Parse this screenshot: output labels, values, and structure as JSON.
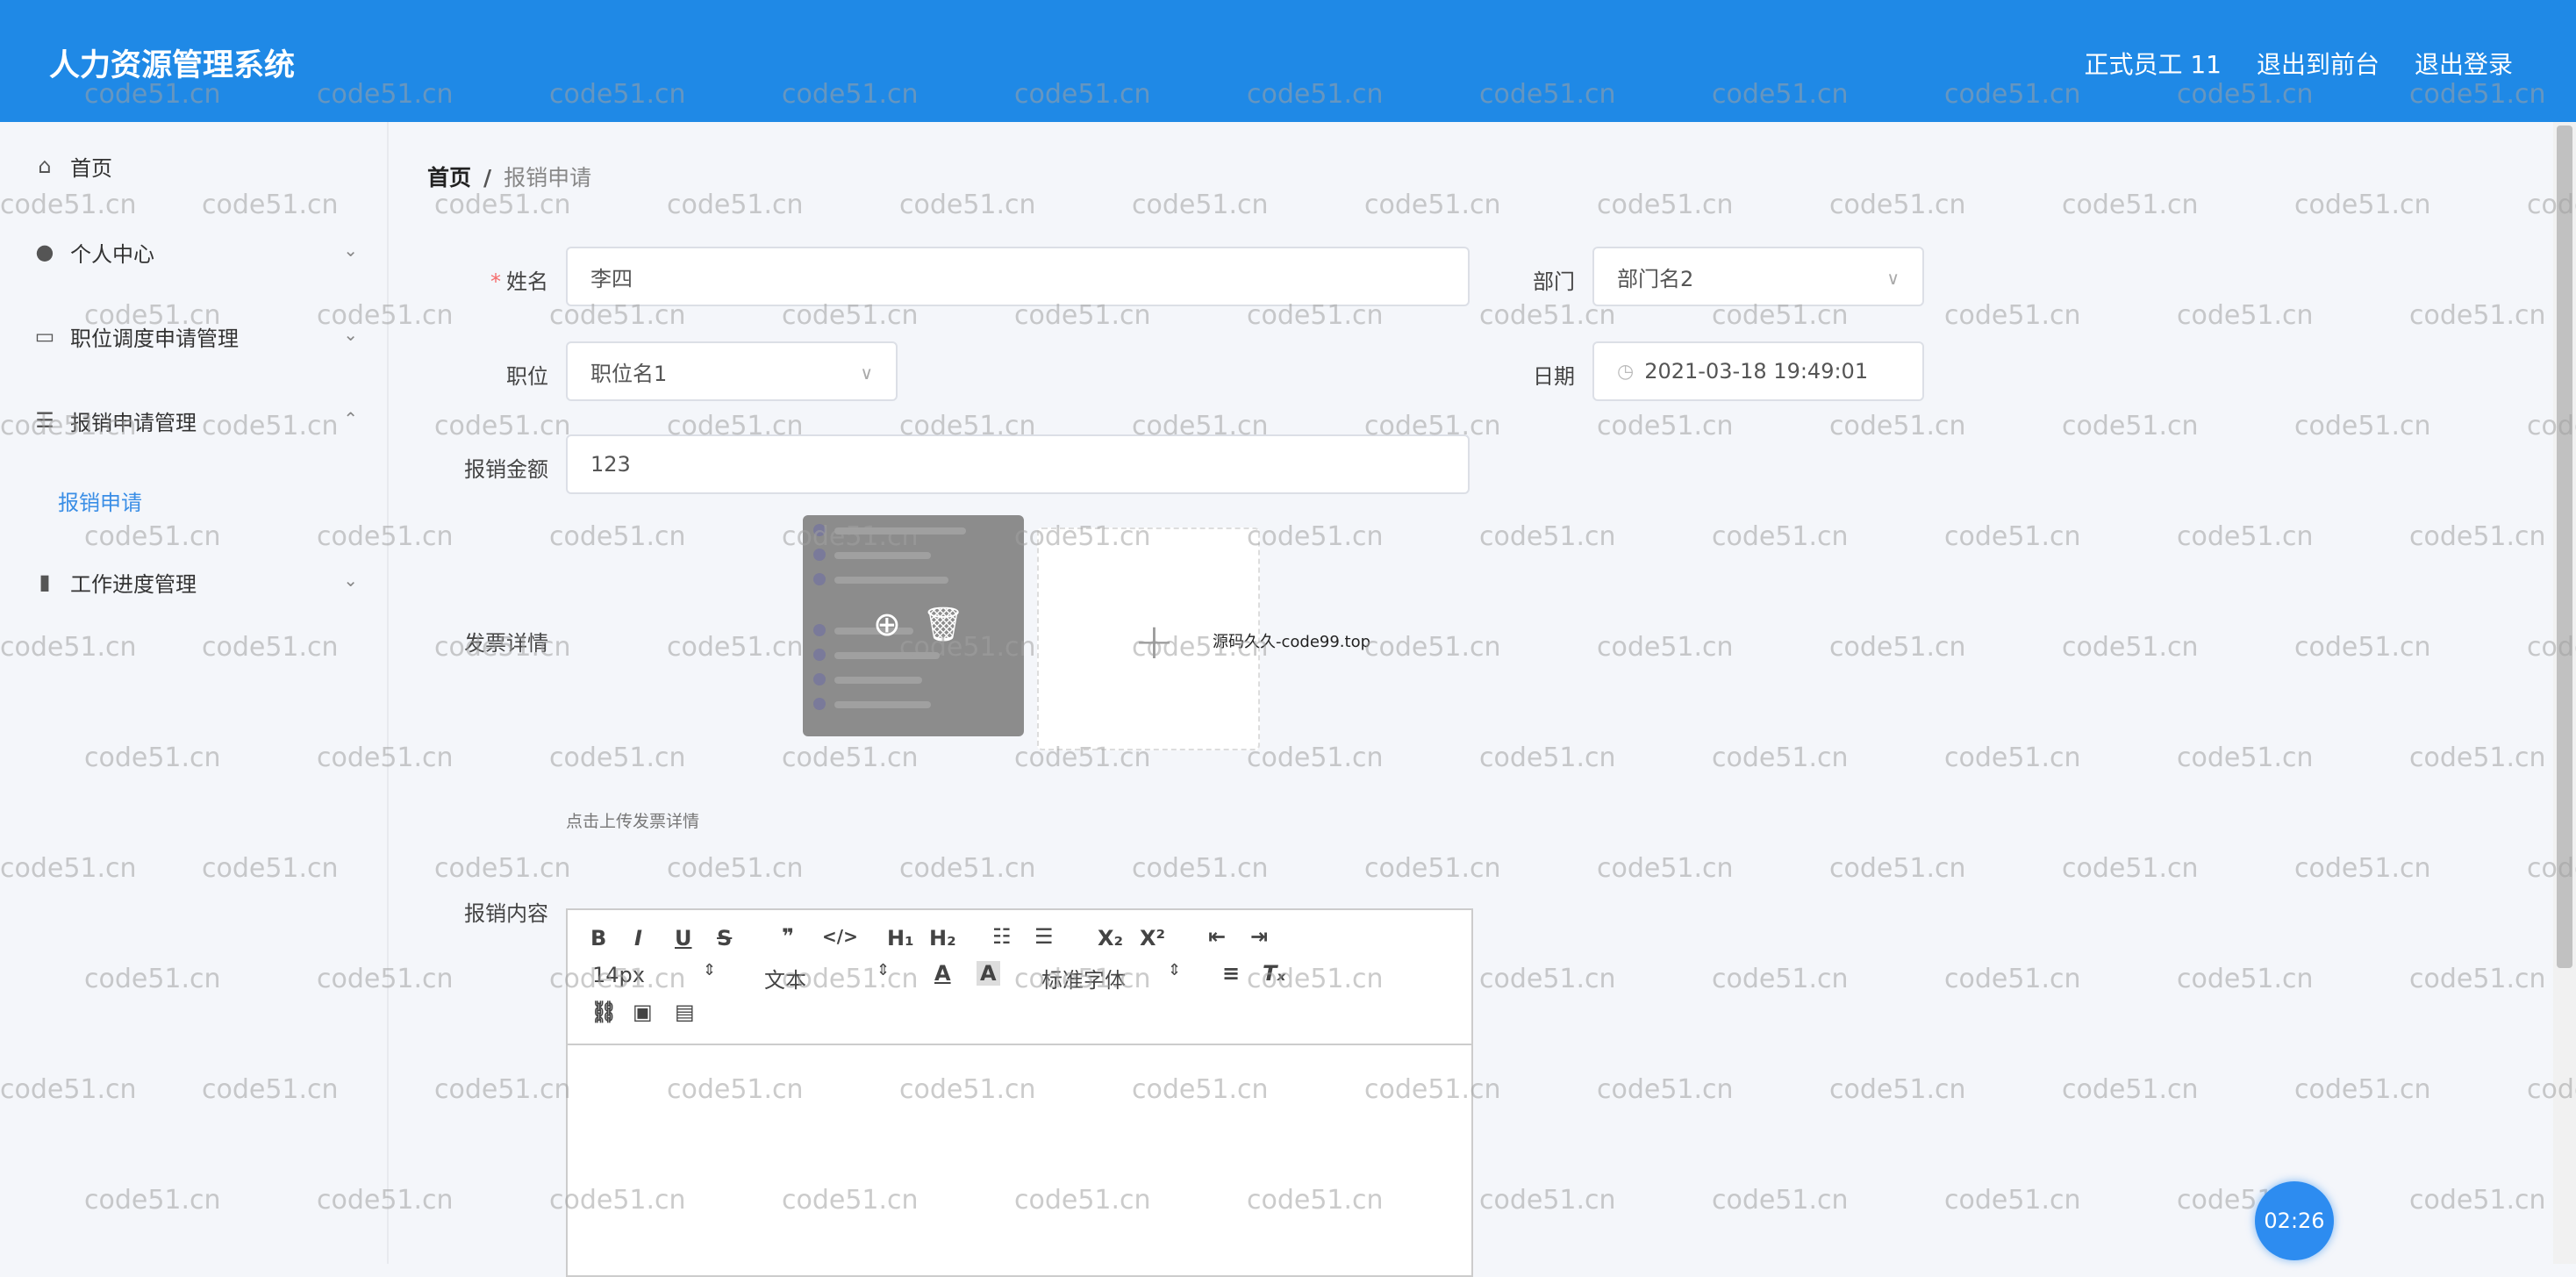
{
  "header": {
    "title": "人力资源管理系统",
    "nav": [
      "正式员工 11",
      "退出到前台",
      "退出登录"
    ],
    "bg_color": "#1f89e6"
  },
  "sidebar": {
    "items": [
      {
        "label": "首页",
        "icon": "home-icon"
      },
      {
        "label": "个人中心",
        "icon": "user-icon"
      },
      {
        "label": "职位调度申请管理",
        "icon": "chat-icon"
      },
      {
        "label": "报销申请管理",
        "icon": "list-icon"
      },
      {
        "label": "报销申请",
        "icon": ""
      },
      {
        "label": "工作进度管理",
        "icon": "bar-chart-icon"
      }
    ]
  },
  "breadcrumb": {
    "home": "首页",
    "current": "报销申请"
  },
  "form": {
    "name_label": "姓名",
    "name_value": "李四",
    "dept_label": "部门",
    "dept_value": "部门名2",
    "position_label": "职位",
    "position_value": "职位名1",
    "date_label": "日期",
    "date_value": "2021-03-18 19:49:01",
    "amount_label": "报销金额",
    "amount_value": "123",
    "invoice_label": "发票详情",
    "invoice_hint": "点击上传发票详情",
    "upload_tag": "源码久久-code99.top",
    "content_label": "报销内容"
  },
  "editor": {
    "font_size": "14px",
    "text_format": "文本",
    "font_family": "标准字体"
  },
  "watermark": "code51.cn",
  "timer": "02:26"
}
